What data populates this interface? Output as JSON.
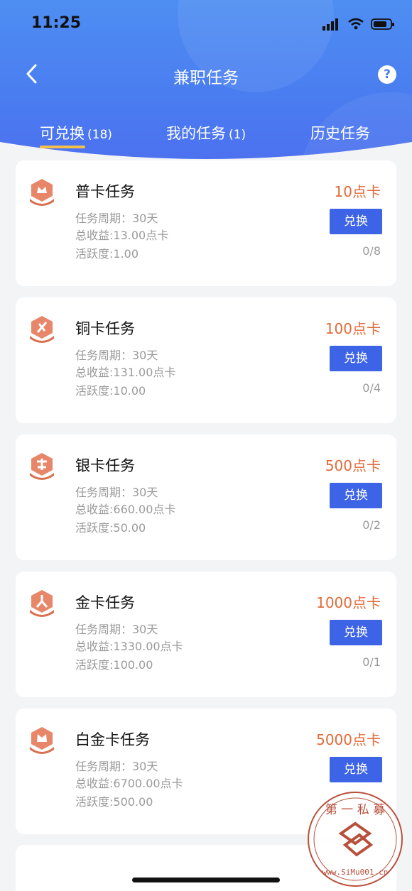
{
  "status_bar": {
    "time": "11:25"
  },
  "navbar": {
    "title": "兼职任务",
    "help_icon": "?"
  },
  "tabs": [
    {
      "label": "可兑换",
      "count": "(18)",
      "active": true
    },
    {
      "label": "我的任务",
      "count": "(1)",
      "active": false
    },
    {
      "label": "历史任务",
      "count": "",
      "active": false
    }
  ],
  "cards": [
    {
      "title": "普卡任务",
      "period": "任务周期：30天",
      "income": "总收益:13.00点卡",
      "activity": "活跃度:1.00",
      "price": "10点卡",
      "button": "兑换",
      "progress": "0/8"
    },
    {
      "title": "铜卡任务",
      "period": "任务周期：30天",
      "income": "总收益:131.00点卡",
      "activity": "活跃度:10.00",
      "price": "100点卡",
      "button": "兑换",
      "progress": "0/4"
    },
    {
      "title": "银卡任务",
      "period": "任务周期：30天",
      "income": "总收益:660.00点卡",
      "activity": "活跃度:50.00",
      "price": "500点卡",
      "button": "兑换",
      "progress": "0/2"
    },
    {
      "title": "金卡任务",
      "period": "任务周期：30天",
      "income": "总收益:1330.00点卡",
      "activity": "活跃度:100.00",
      "price": "1000点卡",
      "button": "兑换",
      "progress": "0/1"
    },
    {
      "title": "白金卡任务",
      "period": "任务周期：30天",
      "income": "总收益:6700.00点卡",
      "activity": "活跃度:500.00",
      "price": "5000点卡",
      "button": "兑换",
      "progress": ""
    }
  ],
  "watermark": {
    "top_text": "第 一 私 募",
    "bottom_text": "www.SiMu001.cn"
  },
  "colors": {
    "accent": "#3d63e6",
    "price": "#e26a3a",
    "header": "#4a7cf0",
    "tab_underline": "#f5c04a"
  }
}
